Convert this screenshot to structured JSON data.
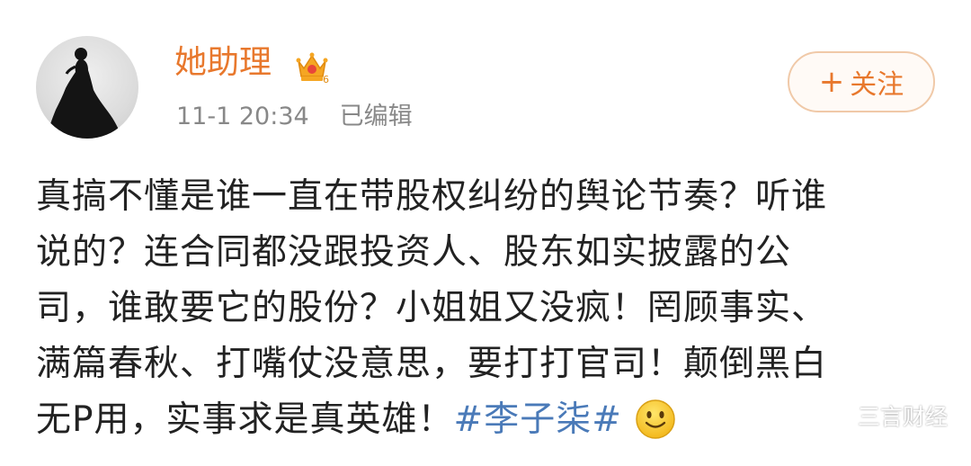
{
  "post": {
    "author": {
      "name": "她助理",
      "avatar_icon": "avatar-silhouette",
      "badge_icon": "crown-vip-icon",
      "badge_level": "6"
    },
    "meta": {
      "timestamp": "11-1 20:34",
      "edited_label": "已编辑"
    },
    "follow_button": {
      "plus": "+",
      "label": "关注"
    },
    "content": {
      "lines": [
        "真搞不懂是谁一直在带股权纠纷的舆论节奏？听谁",
        "说的？连合同都没跟投资人、股东如实披露的公",
        "司，谁敢要它的股份？小姐姐又没疯！罔顾事实、",
        "满篇春秋、打嘴仗没意思，要打打官司！颠倒黑白"
      ],
      "last_line_text": "无P用，实事求是真英雄！",
      "hashtag": "#李子柒#",
      "emoji_icon": "smile-emoji-icon"
    }
  },
  "watermark": {
    "icon": "wechat-icon",
    "text": "三言财经"
  },
  "colors": {
    "username": "#e8782d",
    "hashtag": "#4a7ab8",
    "meta": "#888888",
    "text": "#222222",
    "follow_border": "#f0c9a8"
  }
}
